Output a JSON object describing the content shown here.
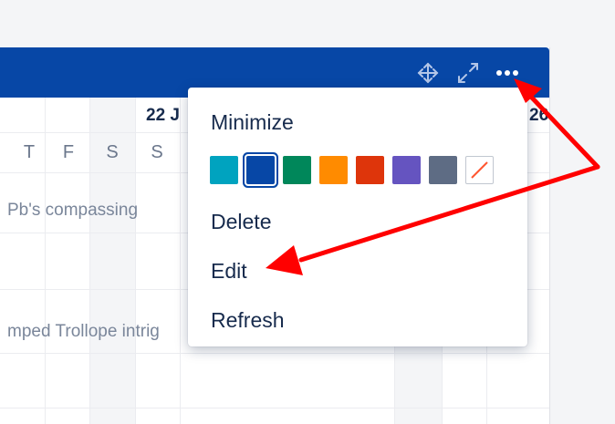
{
  "header": {
    "background": "#0747a6",
    "icons": [
      "move-icon",
      "expand-icon",
      "more-icon"
    ]
  },
  "calendar": {
    "dates": [
      "22 J",
      "26"
    ],
    "days": [
      "T",
      "F",
      "S",
      "S"
    ],
    "rows": [
      "Pb's compassing",
      "mped Trollope intrig"
    ]
  },
  "menu": {
    "minimize": "Minimize",
    "delete": "Delete",
    "edit": "Edit",
    "refresh": "Refresh",
    "colors": [
      "#00a3bf",
      "#0747a6",
      "#00875a",
      "#ff8b00",
      "#de350b",
      "#6554c0",
      "#5e6c84"
    ],
    "selected_color": "#0747a6"
  },
  "annotation": {
    "arrow_color": "#ff0000"
  }
}
